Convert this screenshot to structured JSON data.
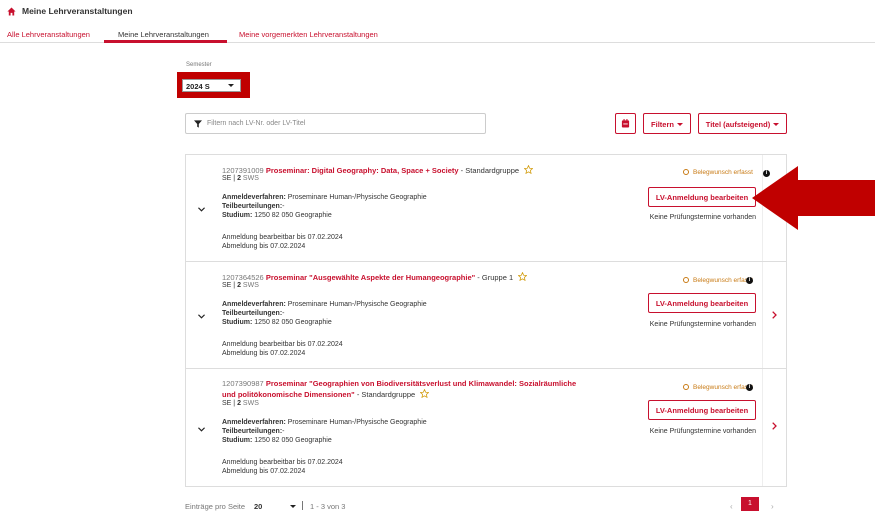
{
  "header": {
    "title": "Meine Lehrveranstaltungen"
  },
  "tabs": [
    {
      "label": "Alle Lehrveranstaltungen"
    },
    {
      "label": "Meine Lehrveranstaltungen"
    },
    {
      "label": "Meine vorgemerkten Lehrveranstaltungen"
    }
  ],
  "semester": {
    "label": "Semester",
    "value": "2024 S"
  },
  "filter": {
    "placeholder": "Filtern nach LV-Nr. oder LV-Titel"
  },
  "toolbar": {
    "filter_label": "Filtern",
    "sort_label": "Titel (aufsteigend)"
  },
  "courses": [
    {
      "number": "1207391009",
      "title": "Proseminar: Digital Geography: Data, Space + Society",
      "title_line2": "",
      "group": " - Standardgruppe",
      "type": "SE |",
      "hours": "2",
      "hours_unit": "SWS",
      "registration_label": "Anmeldeverfahren:",
      "registration_value": " Proseminare Human-/Physische Geographie",
      "partial_label": "Teilbeurteilungen:",
      "partial_value": "-",
      "study_label": "Studium:",
      "study_value": " 1250 82 050 Geographie",
      "edit_until": "Anmeldung bearbeitbar bis 07.02.2024",
      "deregister_until": "Abmeldung bis 07.02.2024",
      "status": "Belegwunsch erfasst",
      "edit_button": "LV-Anmeldung bearbeiten",
      "exam_text": "Keine Prüfungstermine vorhanden"
    },
    {
      "number": "1207364526",
      "title": "Proseminar \"Ausgewählte Aspekte der Humangeographie\"",
      "title_line2": "",
      "group": " - Gruppe 1",
      "type": "SE |",
      "hours": "2",
      "hours_unit": "SWS",
      "registration_label": "Anmeldeverfahren:",
      "registration_value": " Proseminare Human-/Physische Geographie",
      "partial_label": "Teilbeurteilungen:",
      "partial_value": "-",
      "study_label": "Studium:",
      "study_value": " 1250 82 050 Geographie",
      "edit_until": "Anmeldung bearbeitbar bis 07.02.2024",
      "deregister_until": "Abmeldung bis 07.02.2024",
      "status": "Belegwunsch erfasst",
      "edit_button": "LV-Anmeldung bearbeiten",
      "exam_text": "Keine Prüfungstermine vorhanden"
    },
    {
      "number": "1207390987",
      "title": "Proseminar \"Geographien von Biodiversitätsverlust und Klimawandel: Sozialräumliche",
      "title_line2": "und politökonomische Dimensionen\"",
      "group": " - Standardgruppe",
      "type": "SE |",
      "hours": "2",
      "hours_unit": "SWS",
      "registration_label": "Anmeldeverfahren:",
      "registration_value": " Proseminare Human-/Physische Geographie",
      "partial_label": "Teilbeurteilungen:",
      "partial_value": "-",
      "study_label": "Studium:",
      "study_value": " 1250 82 050 Geographie",
      "edit_until": "Anmeldung bearbeitbar bis 07.02.2024",
      "deregister_until": "Abmeldung bis 07.02.2024",
      "status": "Belegwunsch erfasst",
      "edit_button": "LV-Anmeldung bearbeiten",
      "exam_text": "Keine Prüfungstermine vorhanden"
    }
  ],
  "footer": {
    "per_page_label": "Einträge pro Seite",
    "per_page_value": "20",
    "range": "1 - 3 von 3",
    "current_page": "1"
  },
  "colors": {
    "accent": "#c8102e",
    "highlight": "#c00000",
    "status": "#c87a14"
  }
}
